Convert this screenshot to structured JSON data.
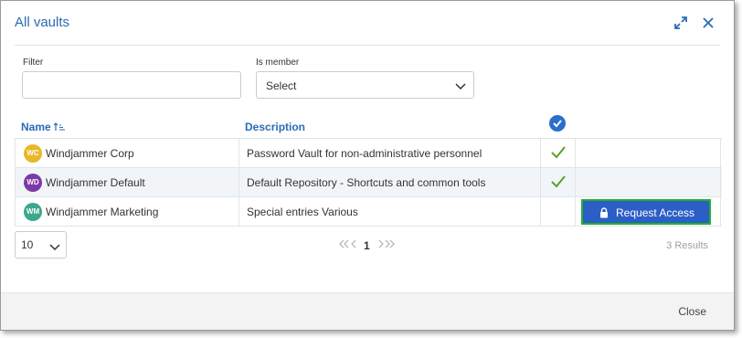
{
  "dialog": {
    "title": "All vaults",
    "close_label": "Close"
  },
  "filters": {
    "filter_label": "Filter",
    "filter_value": "",
    "member_label": "Is member",
    "member_value": "Select"
  },
  "table": {
    "headers": {
      "name": "Name",
      "description": "Description"
    },
    "rows": [
      {
        "initials": "WC",
        "avatar_color": "#e8b828",
        "name": "Windjammer Corp",
        "description": "Password Vault for non-administrative personnel",
        "is_member": true
      },
      {
        "initials": "WD",
        "avatar_color": "#7b3aa6",
        "name": "Windjammer Default",
        "description": "Default Repository - Shortcuts and common tools",
        "is_member": true
      },
      {
        "initials": "WM",
        "avatar_color": "#3aa88e",
        "name": "Windjammer Marketing",
        "description": "Special entries Various",
        "is_member": false,
        "action_label": "Request Access"
      }
    ]
  },
  "pagination": {
    "page_size": "10",
    "current_page": "1",
    "results": "3 Results"
  },
  "colors": {
    "accent": "#2b6bb5",
    "button": "#2c5ec7",
    "check": "#5aa02c",
    "highlight": "#22b02f"
  }
}
